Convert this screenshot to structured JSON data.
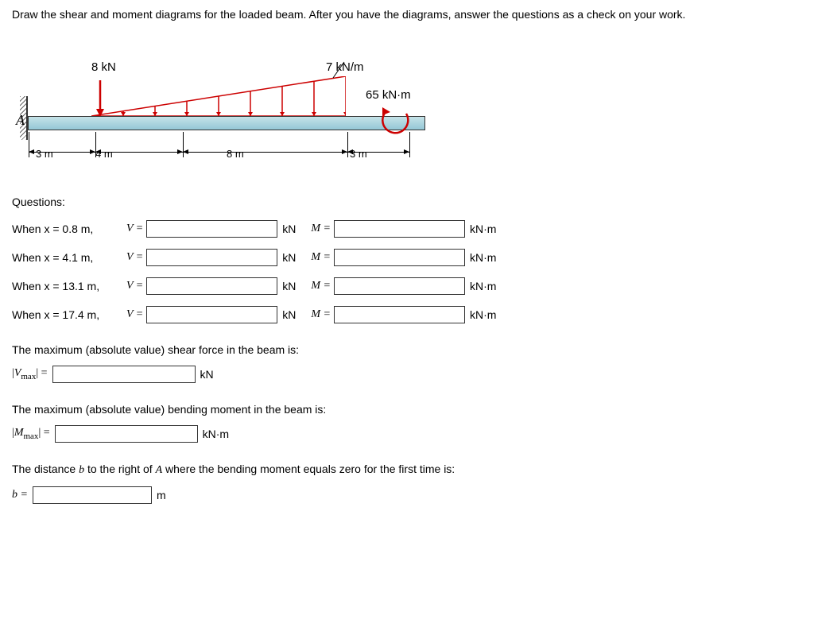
{
  "problem": {
    "statement": "Draw the shear and moment diagrams for the loaded beam. After you have the diagrams, answer the questions as a check on your work."
  },
  "diagram": {
    "label_A": "A",
    "point_load": "8 kN",
    "distributed_load": "7 kN/m",
    "moment": "65 kN·m",
    "dim1": "3 m",
    "dim2": "4 m",
    "dim3": "8 m",
    "dim4": "3 m"
  },
  "questions": {
    "header": "Questions:",
    "rows": [
      {
        "label": "When x = 0.8 m,",
        "var_v": "V =",
        "unit_v": "kN",
        "var_m": "M =",
        "unit_m": "kN·m"
      },
      {
        "label": "When x = 4.1 m,",
        "var_v": "V =",
        "unit_v": "kN",
        "var_m": "M =",
        "unit_m": "kN·m"
      },
      {
        "label": "When x = 13.1 m,",
        "var_v": "V =",
        "unit_v": "kN",
        "var_m": "M =",
        "unit_m": "kN·m"
      },
      {
        "label": "When x = 17.4 m,",
        "var_v": "V =",
        "unit_v": "kN",
        "var_m": "M =",
        "unit_m": "kN·m"
      }
    ]
  },
  "max_shear": {
    "text": "The maximum (absolute value) shear force in the beam is:",
    "label": "|Vmax| =",
    "unit": "kN"
  },
  "max_moment": {
    "text": "The maximum (absolute value) bending moment in the beam is:",
    "label": "|Mmax| =",
    "unit": "kN·m"
  },
  "distance_b": {
    "text_pre": "The distance ",
    "text_var_b": "b",
    "text_mid": " to the right of ",
    "text_var_A": "A",
    "text_post": " where the bending moment equals zero for the first time is:",
    "label": "b =",
    "unit": "m"
  }
}
